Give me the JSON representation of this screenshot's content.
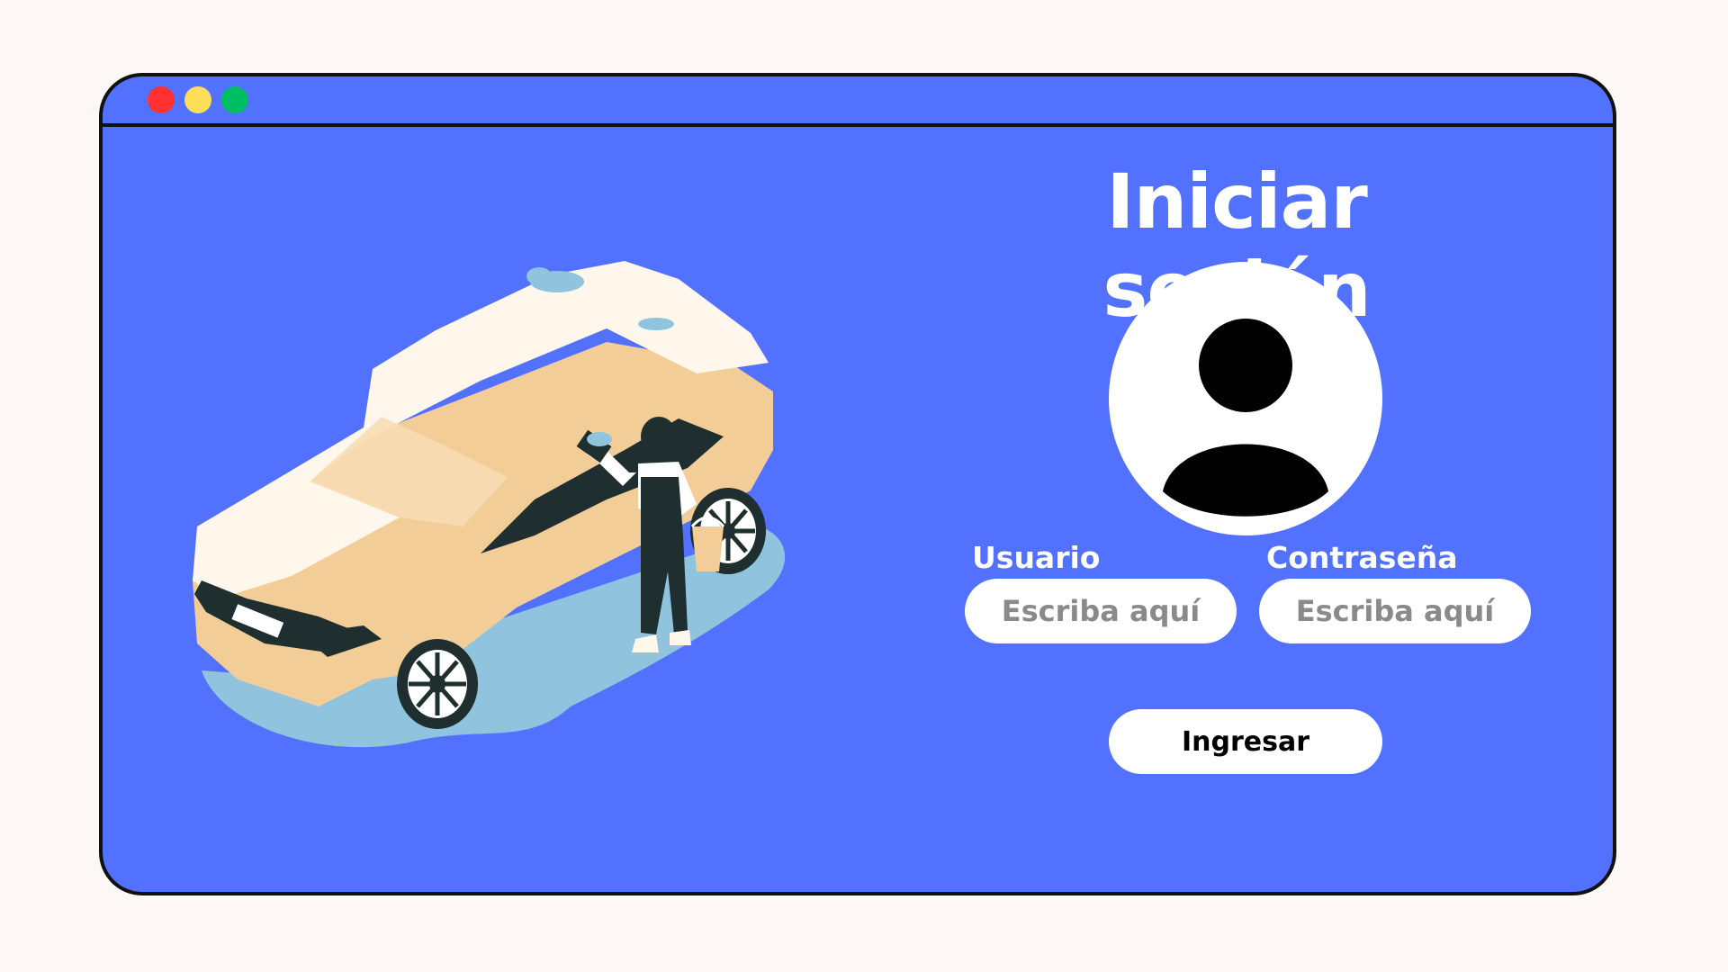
{
  "window": {
    "controls": [
      {
        "name": "close",
        "color": "#ff3131"
      },
      {
        "name": "minimize",
        "color": "#ffde59"
      },
      {
        "name": "maximize",
        "color": "#00bf63"
      }
    ]
  },
  "illustration": {
    "subject": "car-wash-illustration",
    "colors": {
      "car_body": "#f3cd98",
      "car_top": "#fff7ec",
      "glass": "#1f2e2e",
      "water": "#8fc3de",
      "worker_dark": "#1f2e2e",
      "worker_shirt": "#ffffff"
    }
  },
  "login": {
    "title": "Iniciar sesión",
    "avatar_icon": "user-avatar-icon",
    "username_label": "Usuario",
    "username_placeholder": "Escriba aquí",
    "password_label": "Contraseña",
    "password_placeholder": "Escriba aquí",
    "submit_label": "Ingresar"
  },
  "colors": {
    "page_background": "#fdf7f5",
    "window_background": "#5271ff",
    "text_on_window": "#ffffff",
    "field_background": "#ffffff",
    "placeholder": "#8a8a8a"
  }
}
